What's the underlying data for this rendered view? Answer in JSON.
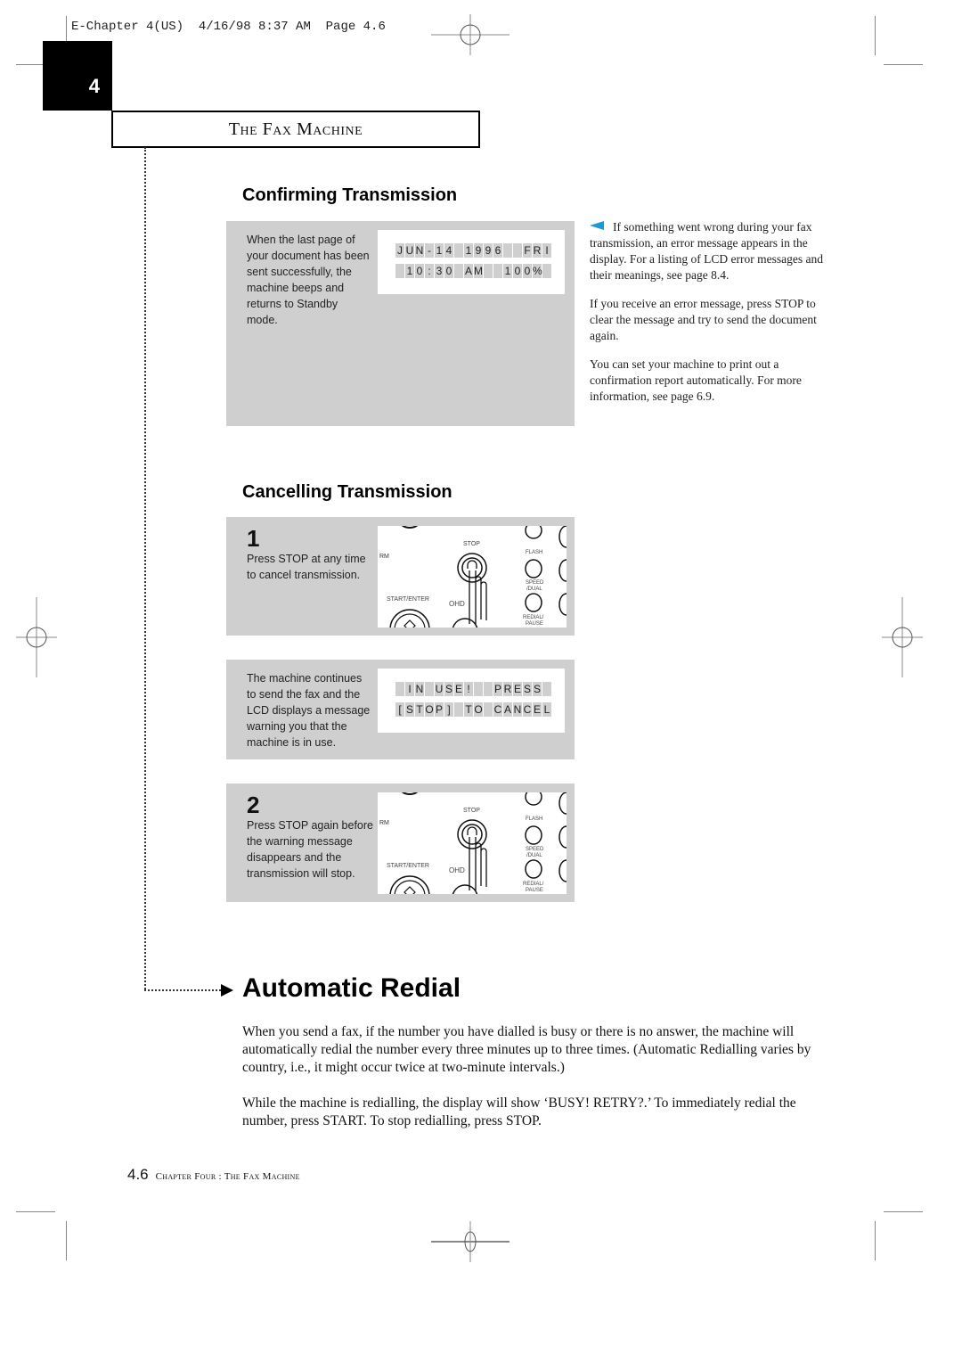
{
  "slug": "E-Chapter 4(US)  4/16/98 8:37 AM  Page 4.6",
  "chapter_tab": "4",
  "chapter_title": "The Fax Machine",
  "confirming": {
    "heading": "Confirming Transmission",
    "panel_text": "When the last page of your document has been sent successfully, the machine beeps and returns to Standby mode.",
    "lcd_rows": [
      "JUN-14 1996  FRI",
      " 10:30 AM  100% "
    ]
  },
  "side_notes": [
    "If something went wrong during your fax transmission, an error message appears in the display. For a listing of LCD error messages and their meanings, see page 8.4.",
    "If you receive an error message, press STOP to clear the message and try to send the document again.",
    "You can set your machine to print out a confirmation report automatically. For more information, see page 6.9."
  ],
  "cancelling": {
    "heading": "Cancelling Transmission",
    "step1": {
      "num": "1",
      "text": "Press STOP at any time to cancel transmission."
    },
    "warning_text": "The machine continues to send the fax and the LCD displays a message warning you that the machine is in use.",
    "lcd_rows": [
      " IN USE!  PRESS ",
      "[STOP] TO CANCEL"
    ],
    "step2": {
      "num": "2",
      "text": "Press STOP again before the warning message disappears and the transmission will stop."
    },
    "keypad_labels": {
      "stop": "STOP",
      "flash": "FLASH",
      "speed": "SPEED",
      "dual": "/DUAL",
      "start": "START/ENTER",
      "ohd": "OHD",
      "redial": "REDIAL/",
      "pause": "PAUSE",
      "rm": "RM"
    }
  },
  "auto_redial": {
    "heading": "Automatic Redial",
    "paragraphs": [
      "When you send a fax, if the number you have dialled is busy or there is no answer, the machine will automatically redial the number every three minutes up to three times. (Automatic Redialling varies by country, i.e., it might occur twice at two-minute intervals.)",
      "While the machine is redialling, the display will show ‘BUSY! RETRY?.’ To immediately redial the number, press START. To stop redialling, press STOP."
    ]
  },
  "footer": {
    "page": "4.6",
    "text": "Chapter Four : The Fax Machine"
  },
  "colors": {
    "panel": "#cfcfcf",
    "accent_arrow": "#1a9ad6"
  }
}
